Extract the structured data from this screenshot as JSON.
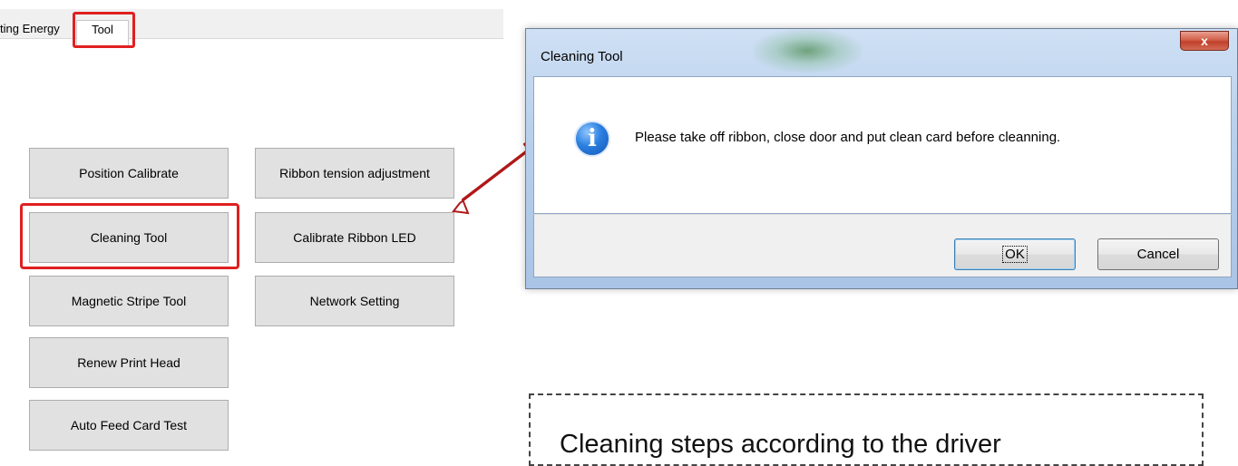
{
  "tabs": {
    "previous_partial": "ting Energy",
    "active": "Tool"
  },
  "buttons": {
    "position_calibrate": "Position Calibrate",
    "cleaning_tool": "Cleaning Tool",
    "magnetic_stripe_tool": "Magnetic Stripe Tool",
    "renew_print_head": "Renew Print Head",
    "auto_feed_card_test": "Auto Feed Card Test",
    "ribbon_tension_adjustment": "Ribbon tension adjustment",
    "calibrate_ribbon_led": "Calibrate Ribbon LED",
    "network_setting": "Network Setting"
  },
  "dialog": {
    "title": "Cleaning Tool",
    "close_label": "x",
    "message": "Please take off ribbon, close door and put clean card before cleanning.",
    "ok_label": "OK",
    "cancel_label": "Cancel",
    "icon": "info-icon"
  },
  "caption": {
    "text": "Cleaning steps according to the driver"
  },
  "colors": {
    "highlight": "#e02020",
    "arrow": "#b01818"
  }
}
